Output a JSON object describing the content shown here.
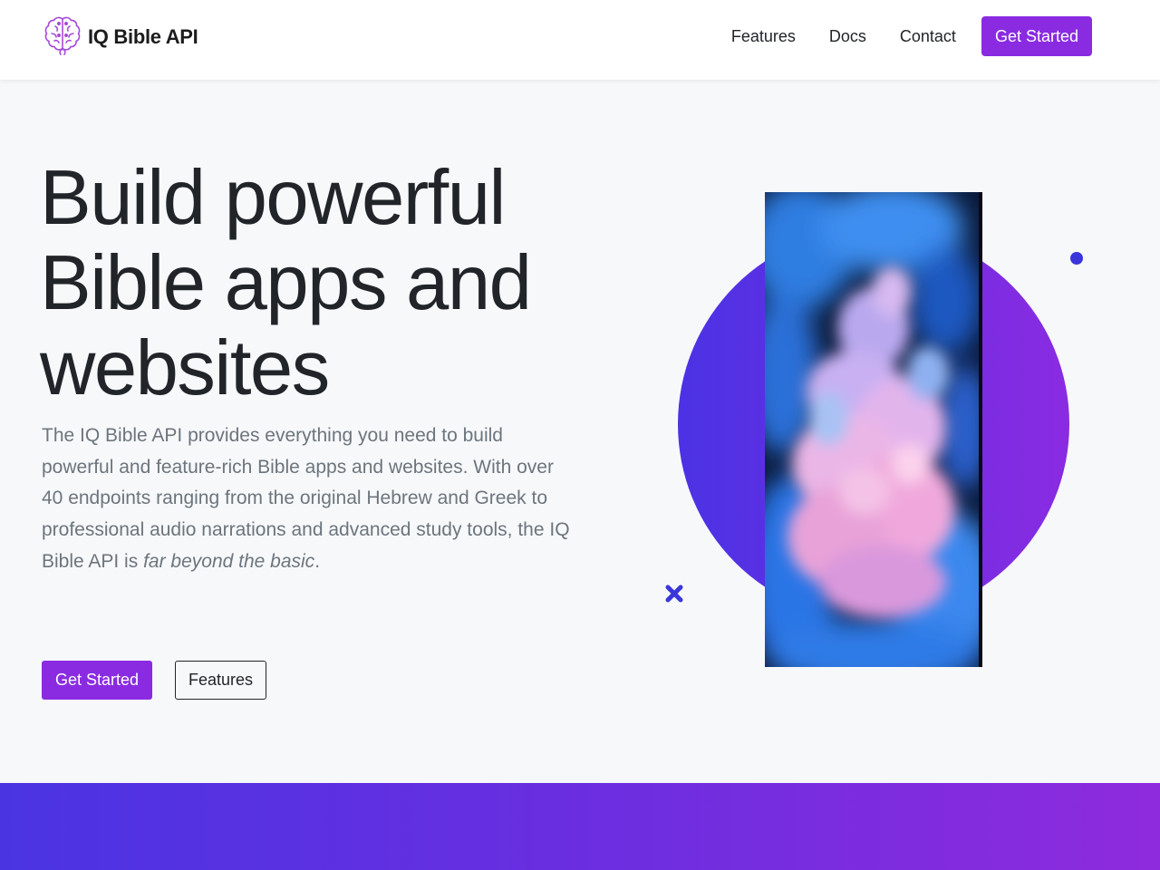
{
  "brand": {
    "name": "IQ Bible API",
    "logo_icon": "brain-icon",
    "color": "#8a2be2"
  },
  "nav": {
    "links": [
      "Features",
      "Docs",
      "Contact"
    ],
    "cta": "Get Started"
  },
  "hero": {
    "title_lines": [
      "Build powerful",
      "Bible apps and",
      "websites"
    ],
    "paragraph": "The IQ Bible API provides everything you need to build powerful and feature-rich Bible apps and websites. With over 40 endpoints ranging from the original Hebrew and Greek to professional audio narrations and advanced study tools, the IQ Bible API is ",
    "paragraph_emphasis": "far beyond the basic",
    "paragraph_end": ".",
    "primary_button": "Get Started",
    "secondary_button": "Features"
  },
  "colors": {
    "accent": "#8a2be2",
    "gradient_start": "#4b32e4",
    "gradient_end": "#8a2be2",
    "text_muted": "#6c757d"
  }
}
